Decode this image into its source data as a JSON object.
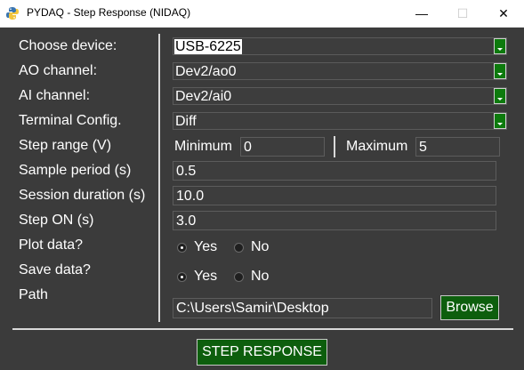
{
  "window": {
    "title": "PYDAQ - Step Response (NIDAQ)",
    "app_icon": "python-icon",
    "min_glyph": "—",
    "max_glyph": "☐",
    "close_glyph": "✕"
  },
  "labels": {
    "device": "Choose device:",
    "ao": "AO channel:",
    "ai": "AI channel:",
    "terminal": "Terminal Config.",
    "step_range": "Step range (V)",
    "sample_period": "Sample period (s)",
    "session_duration": "Session duration (s)",
    "step_on": "Step ON (s)",
    "plot": "Plot data?",
    "save": "Save data?",
    "path": "Path"
  },
  "combos": {
    "device": "USB-6225",
    "ao": "Dev2/ao0",
    "ai": "Dev2/ai0",
    "terminal": "Diff"
  },
  "step_range": {
    "min_label": "Minimum",
    "min_value": "0",
    "max_label": "Maximum",
    "max_value": "5"
  },
  "fields": {
    "sample_period": "0.5",
    "session_duration": "10.0",
    "step_on": "3.0",
    "path": "C:\\Users\\Samir\\Desktop"
  },
  "plot": {
    "yes": "Yes",
    "no": "No",
    "selected": "Yes"
  },
  "save": {
    "yes": "Yes",
    "no": "No",
    "selected": "Yes"
  },
  "buttons": {
    "browse": "Browse",
    "step_response": "STEP RESPONSE"
  },
  "colors": {
    "background": "#3b3b3b",
    "accent_green": "#0d7a0d",
    "button_green": "#0d5e0d",
    "text": "#ffffff"
  }
}
